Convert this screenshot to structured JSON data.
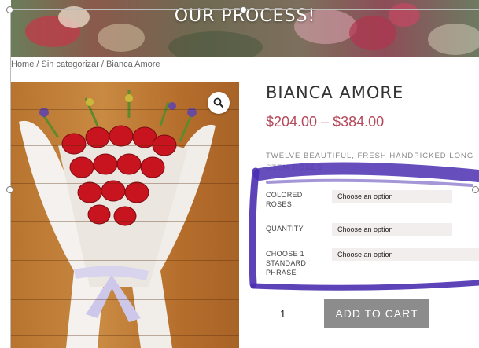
{
  "hero": {
    "title": "OUR PROCESS!"
  },
  "breadcrumb": {
    "text": "Home / Sin categorizar / Bianca Amore"
  },
  "product": {
    "title": "BIANCA AMORE",
    "price": "$204.00 – $384.00",
    "description": "TWELVE BEAUTIFUL, FRESH HANDPICKED LONG",
    "description_cont": "STEM ROSES"
  },
  "variations": [
    {
      "label": "COLORED ROSES",
      "value": "Choose an option"
    },
    {
      "label": "QUANTITY",
      "value": "Choose an option"
    },
    {
      "label": "CHOOSE 1 STANDARD PHRASE",
      "value": "Choose an option"
    }
  ],
  "cart": {
    "quantity": "1",
    "add_label": "ADD TO CART"
  },
  "icons": {
    "zoom": "magnifier-icon"
  },
  "colors": {
    "price": "#b5485a",
    "button": "#8c8c8c",
    "annotation": "#4b2fb0"
  }
}
